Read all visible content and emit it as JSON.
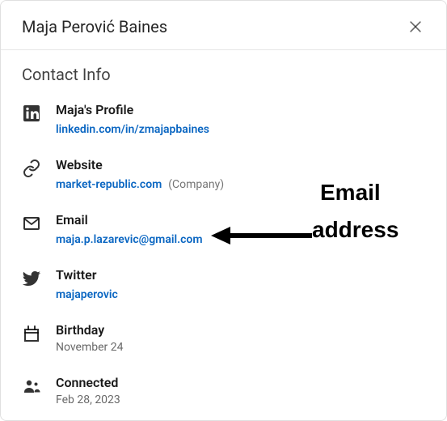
{
  "header": {
    "title": "Maja Perović Baines"
  },
  "section_title": "Contact Info",
  "items": {
    "profile": {
      "label": "Maja's Profile",
      "link": "linkedin.com/in/zmajapbaines"
    },
    "website": {
      "label": "Website",
      "link": "market-republic.com",
      "note": "(Company)"
    },
    "email": {
      "label": "Email",
      "link": "maja.p.lazarevic@gmail.com"
    },
    "twitter": {
      "label": "Twitter",
      "link": "majaperovic"
    },
    "birthday": {
      "label": "Birthday",
      "value": "November 24"
    },
    "connected": {
      "label": "Connected",
      "value": "Feb 28, 2023"
    }
  },
  "annotation": {
    "line1": "Email",
    "line2": "address"
  }
}
